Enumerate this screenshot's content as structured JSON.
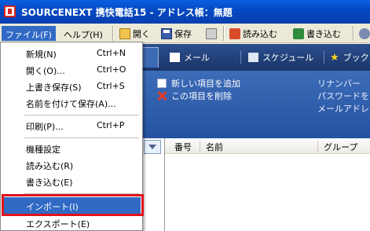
{
  "window": {
    "title": "SOURCENEXT 携快電話15 - アドレス帳：無題"
  },
  "menubar": {
    "items": [
      {
        "label": "ファイル(F)"
      },
      {
        "label": "ヘルプ(H)"
      }
    ]
  },
  "toolbar": {
    "open_label": "開く",
    "save_label": "保存",
    "read_label": "読み込む",
    "write_label": "書き込む"
  },
  "tabs": [
    {
      "label": "メール"
    },
    {
      "label": "スケジュール"
    },
    {
      "label": "ブックマ"
    }
  ],
  "actions": {
    "add_label": "新しい項目を追加",
    "delete_label": "この項目を削除"
  },
  "field_hints": [
    "リナンバー",
    "パスワードを",
    "メールアドレ"
  ],
  "grid": {
    "columns": [
      "番号",
      "名前",
      "グループ"
    ]
  },
  "file_menu": {
    "items": [
      {
        "label": "新規(N)",
        "shortcut": "Ctrl+N"
      },
      {
        "label": "開く(O)...",
        "shortcut": "Ctrl+O"
      },
      {
        "label": "上書き保存(S)",
        "shortcut": "Ctrl+S"
      },
      {
        "label": "名前を付けて保存(A)...",
        "shortcut": ""
      },
      {
        "label": "印刷(P)...",
        "shortcut": "Ctrl+P"
      },
      {
        "label": "機種設定",
        "shortcut": ""
      },
      {
        "label": "読み込む(R)",
        "shortcut": ""
      },
      {
        "label": "書き込む(E)",
        "shortcut": ""
      },
      {
        "label": "インポート(I)",
        "shortcut": ""
      },
      {
        "label": "エクスポート(E)",
        "shortcut": ""
      }
    ]
  },
  "colors": {
    "highlight": "#316ac5",
    "callout_border": "#e2121a",
    "titlebar": "#0348c2"
  }
}
